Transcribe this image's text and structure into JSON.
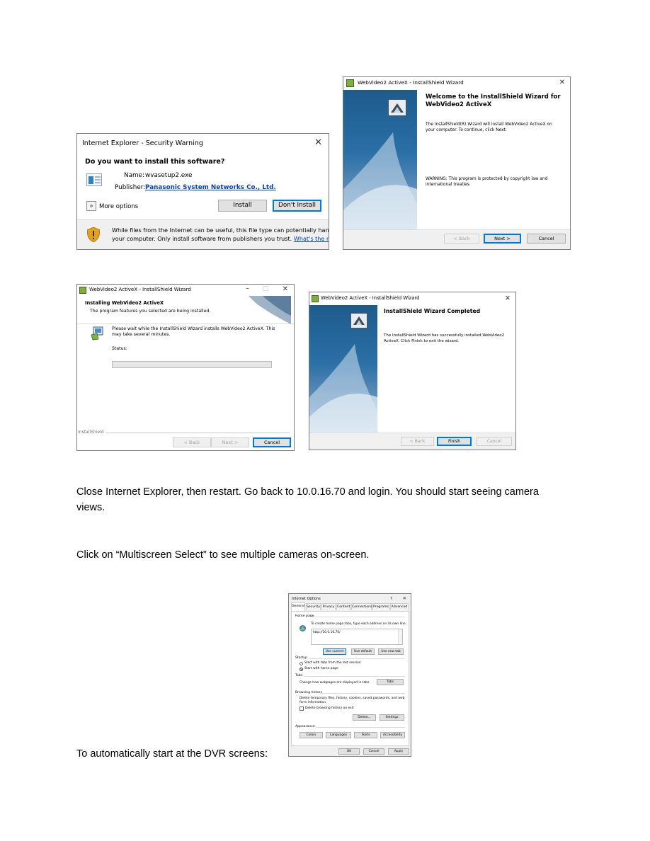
{
  "security_warning": {
    "title": "Internet Explorer - Security Warning",
    "question": "Do you want to install this software?",
    "name_label": "Name:",
    "name_value": "wvasetup2.exe",
    "publisher_label": "Publisher:",
    "publisher_value": "Panasonic System Networks Co., Ltd.",
    "more_options": "More options",
    "install_button": "Install",
    "dont_install_button": "Don't Install",
    "warning_line1": "While files from the Internet can be useful, this file type can potentially harm",
    "warning_line2": "your computer. Only install software from publishers you trust.",
    "risk_link": "What's the risk?"
  },
  "welcome_wizard": {
    "title": "WebVideo2 ActiveX - InstallShield Wizard",
    "heading_line1": "Welcome to the InstallShield Wizard for",
    "heading_line2": "WebVideo2 ActiveX",
    "body_line1": "The InstallShield(R) Wizard will install WebVideo2 ActiveX on",
    "body_line2": "your computer. To continue, click Next.",
    "warning_line1": "WARNING: This program is protected by copyright law and",
    "warning_line2": "international treaties.",
    "back_button": "< Back",
    "next_button": "Next >",
    "cancel_button": "Cancel"
  },
  "installing_wizard": {
    "title": "WebVideo2 ActiveX - InstallShield Wizard",
    "heading": "Installing WebVideo2 ActiveX",
    "subheading": "The program features you selected are being installed.",
    "body_line1": "Please wait while the InstallShield Wizard installs WebVideo2 ActiveX. This",
    "body_line2": "may take several minutes.",
    "status_label": "Status:",
    "progress": 0,
    "brand": "InstallShield",
    "back_button": "< Back",
    "next_button": "Next >",
    "cancel_button": "Cancel"
  },
  "completed_wizard": {
    "title": "WebVideo2 ActiveX - InstallShield Wizard",
    "heading": "InstallShield Wizard Completed",
    "body_line1": "The InstallShield Wizard has successfully installed WebVideo2",
    "body_line2": "ActiveX. Click Finish to exit the wizard.",
    "back_button": "< Back",
    "finish_button": "Finish",
    "cancel_button": "Cancel"
  },
  "instructions": {
    "p1_line1": "Close Internet Explorer, then restart. Go back to 10.0.16.70 and login. You should start seeing camera",
    "p1_line2": "views.",
    "p2": "Click on “Multiscreen Select” to see multiple cameras on-screen.",
    "p3": "To automatically start at the DVR screens:"
  },
  "internet_options": {
    "title": "Internet Options",
    "help": "?",
    "tabs": [
      "General",
      "Security",
      "Privacy",
      "Content",
      "Connections",
      "Programs",
      "Advanced"
    ],
    "home_page_label": "Home page",
    "home_page_hint": "To create home page tabs, type each address on its own line.",
    "home_page_value": "http://10.0.16.70/",
    "use_current": "Use current",
    "use_default": "Use default",
    "use_new_tab": "Use new tab",
    "startup_label": "Startup",
    "startup_option1": "Start with tabs from the last session",
    "startup_option2": "Start with home page",
    "tabs_label": "Tabs",
    "tabs_hint": "Change how webpages are displayed in tabs.",
    "tabs_button": "Tabs",
    "history_label": "Browsing history",
    "history_hint_line1": "Delete temporary files, history, cookies, saved passwords, and web",
    "history_hint_line2": "form information.",
    "delete_on_exit": "Delete browsing history on exit",
    "delete_button": "Delete...",
    "settings_button": "Settings",
    "appearance_label": "Appearance",
    "colors_button": "Colors",
    "languages_button": "Languages",
    "fonts_button": "Fonts",
    "accessibility_button": "Accessibility",
    "ok_button": "OK",
    "cancel_button": "Cancel",
    "apply_button": "Apply"
  },
  "colors": {
    "link": "#0645ad",
    "focus": "#0078d7",
    "wizard_blue": "#2a6fa6"
  }
}
